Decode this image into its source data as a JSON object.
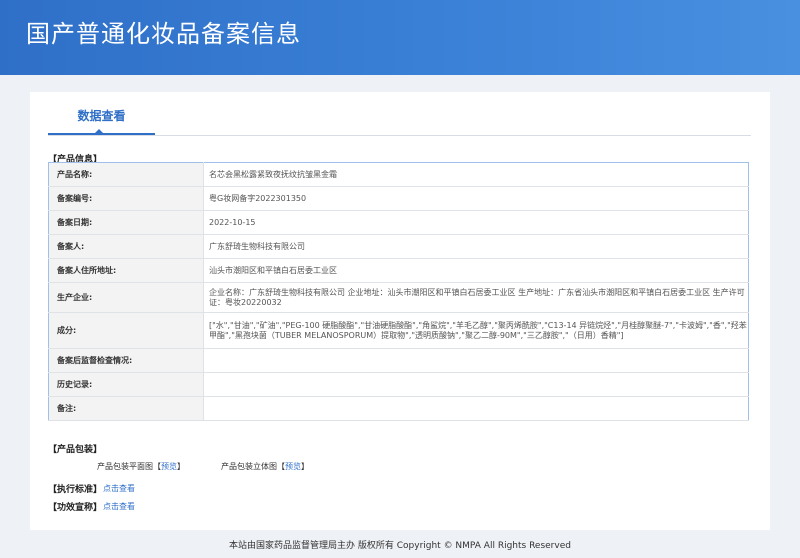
{
  "header": {
    "title": "国产普通化妆品备案信息"
  },
  "tabs": [
    {
      "label": "数据查看"
    }
  ],
  "product_info": {
    "section_label": "【产品信息】",
    "rows": [
      {
        "label": "产品名称:",
        "value": "名芯会黑松露紧致夜抚纹抗皱黑金霜"
      },
      {
        "label": "备案编号:",
        "value": "粤G妆网备字2022301350"
      },
      {
        "label": "备案日期:",
        "value": "2022-10-15"
      },
      {
        "label": "备案人:",
        "value": "广东舒琦生物科技有限公司"
      },
      {
        "label": "备案人住所地址:",
        "value": "汕头市潮阳区和平镇白石居委工业区"
      },
      {
        "label": "生产企业:",
        "value": "企业名称：广东舒琦生物科技有限公司 企业地址：汕头市潮阳区和平镇白石居委工业区 生产地址：广东省汕头市潮阳区和平镇白石居委工业区 生产许可证：粤妆20220032"
      },
      {
        "label": "成分:",
        "value": "[\"水\",\"甘油\",\"矿油\",\"PEG-100 硬脂酸酯\",\"甘油硬脂酸酯\",\"角鲨烷\",\"羊毛乙醇\",\"聚丙烯酰胺\",\"C13-14 异链烷烃\",\"月桂醇聚醚-7\",\"卡波姆\",\"香\",\"羟苯甲酯\",\"黑孢块菌（TUBER MELANOSPORUM）提取物\",\"透明质酸钠\",\"聚乙二醇-90M\",\"三乙醇胺\",\"（日用）香精\"]"
      },
      {
        "label": "备案后监督检查情况:",
        "value": ""
      },
      {
        "label": "历史记录:",
        "value": ""
      },
      {
        "label": "备注:",
        "value": ""
      }
    ]
  },
  "packaging": {
    "section_label": "【产品包装】",
    "flat_label": "产品包装平面图",
    "flat_link": "预览",
    "solid_label": "产品包装立体图",
    "solid_link": "预览"
  },
  "standard": {
    "section_label": "【执行标准】",
    "link": "点击查看"
  },
  "claims": {
    "section_label": "【功效宣称】",
    "link": "点击查看"
  },
  "footer": {
    "text": "本站由国家药品监督管理局主办 版权所有 Copyright © NMPA All Rights Reserved"
  }
}
